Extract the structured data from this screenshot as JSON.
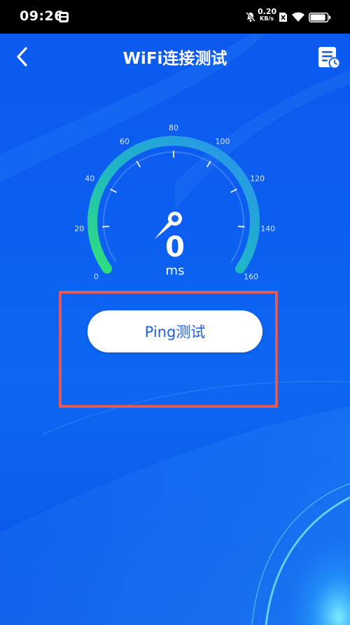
{
  "status_bar": {
    "time": "09:26",
    "net_speed_value": "0.20",
    "net_speed_unit": "KB/s",
    "battery_level": 0.9
  },
  "header": {
    "title": "WiFi连接测试",
    "back_icon": "chevron-left-icon",
    "history_icon": "history-list-icon"
  },
  "gauge": {
    "value": "0",
    "unit": "ms",
    "min": 0,
    "max": 160,
    "tick_labels": [
      "0",
      "20",
      "40",
      "60",
      "80",
      "100",
      "120",
      "140",
      "160"
    ],
    "arc_colors": [
      "#2ee07a",
      "#1fb6c6",
      "#2a8ff0"
    ]
  },
  "actions": {
    "ping_button_label": "Ping测试"
  },
  "colors": {
    "background": "#0c5ef0",
    "button_text": "#1d5fe6",
    "highlight": "#e25a58"
  }
}
